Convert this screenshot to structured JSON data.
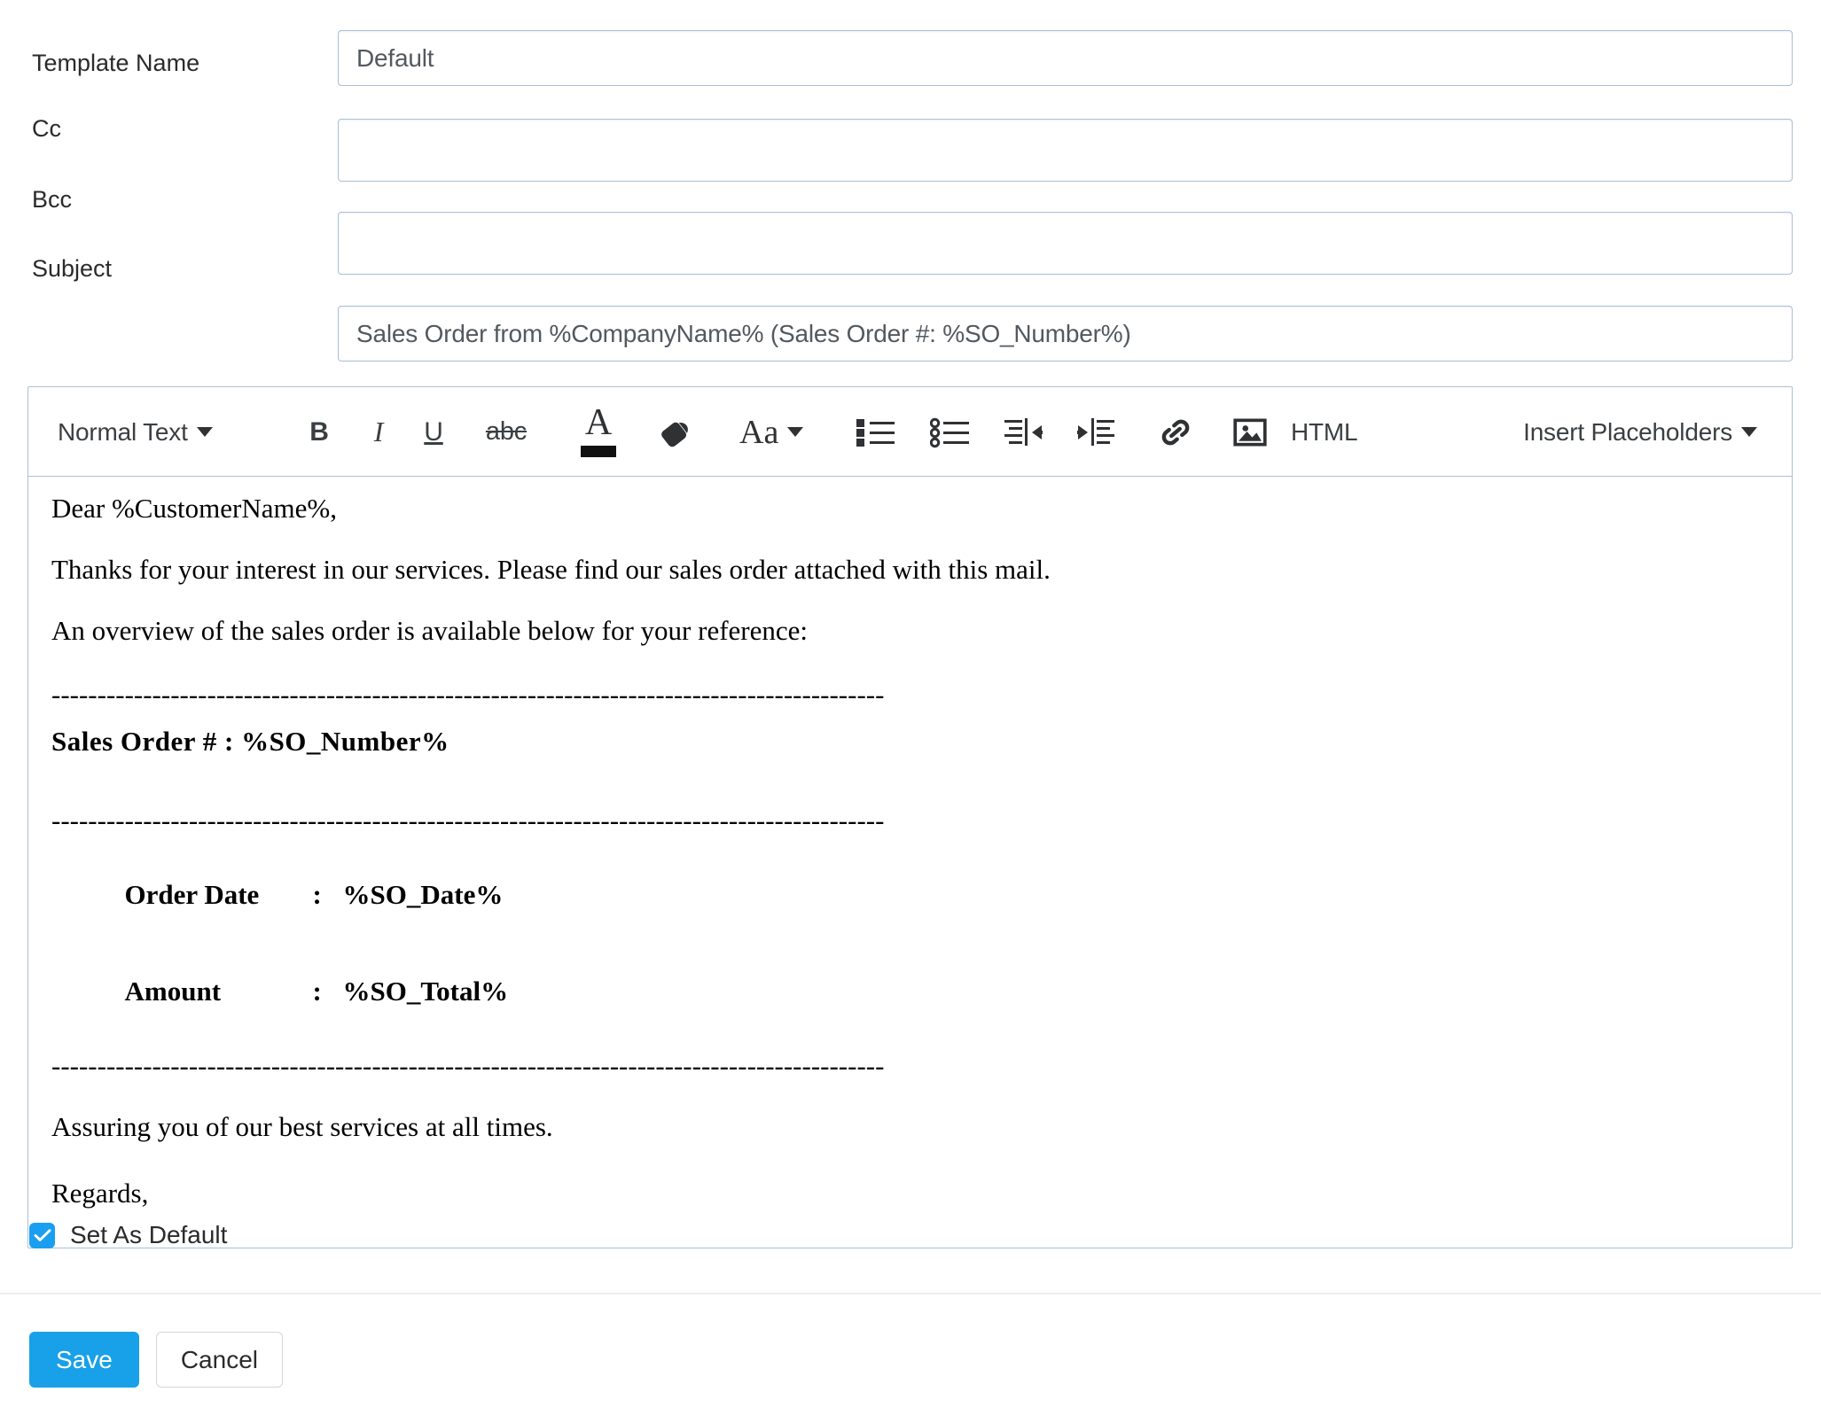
{
  "form": {
    "rows": [
      {
        "label": "Template Name",
        "value": "Default",
        "placeholder": ""
      },
      {
        "label": "Cc",
        "value": "",
        "placeholder": ""
      },
      {
        "label": "Bcc",
        "value": "",
        "placeholder": ""
      },
      {
        "label": "Subject",
        "value": "Sales Order from %CompanyName% (Sales Order #: %SO_Number%)",
        "placeholder": ""
      }
    ]
  },
  "toolbar": {
    "style_select": "Normal Text",
    "bold": "B",
    "italic": "I",
    "underline": "U",
    "strikethrough": "abc",
    "font_color": "A",
    "highlight": "highlight-icon",
    "font_size": "Aa",
    "bullet_list": "bullet-list-icon",
    "ordered_list": "circle-list-icon",
    "outdent": "outdent-icon",
    "indent": "indent-icon",
    "link": "link-icon",
    "image": "image-icon",
    "html": "HTML",
    "placeholders": "Insert Placeholders"
  },
  "body": {
    "greeting": "Dear %CustomerName%,",
    "paragraph1": "Thanks for your interest in our services. Please find our sales order attached with this mail.",
    "paragraph2": "An overview of the sales order is available below for your reference:",
    "rule1": "-------------------------------------------------------------------------------------------",
    "heading": "Sales Order # : %SO_Number%",
    "rule2": "-------------------------------------------------------------------------------------------",
    "detail_rows": [
      {
        "key": "Order Date",
        "sep": ":",
        "value": "%SO_Date%"
      },
      {
        "key": "Amount",
        "sep": ":",
        "value": "%SO_Total%"
      }
    ],
    "rule3": "-------------------------------------------------------------------------------------------",
    "closing": "Assuring you of our best services at all times.",
    "signoff": "Regards,"
  },
  "footer": {
    "set_as_default_label": "Set As Default",
    "set_as_default_checked": true,
    "save_label": "Save",
    "cancel_label": "Cancel"
  },
  "colors": {
    "accent": "#18a0e8",
    "checkbox": "#1a9ff0",
    "field_border": "#a9c0d8",
    "text": "#2b2b2b"
  }
}
